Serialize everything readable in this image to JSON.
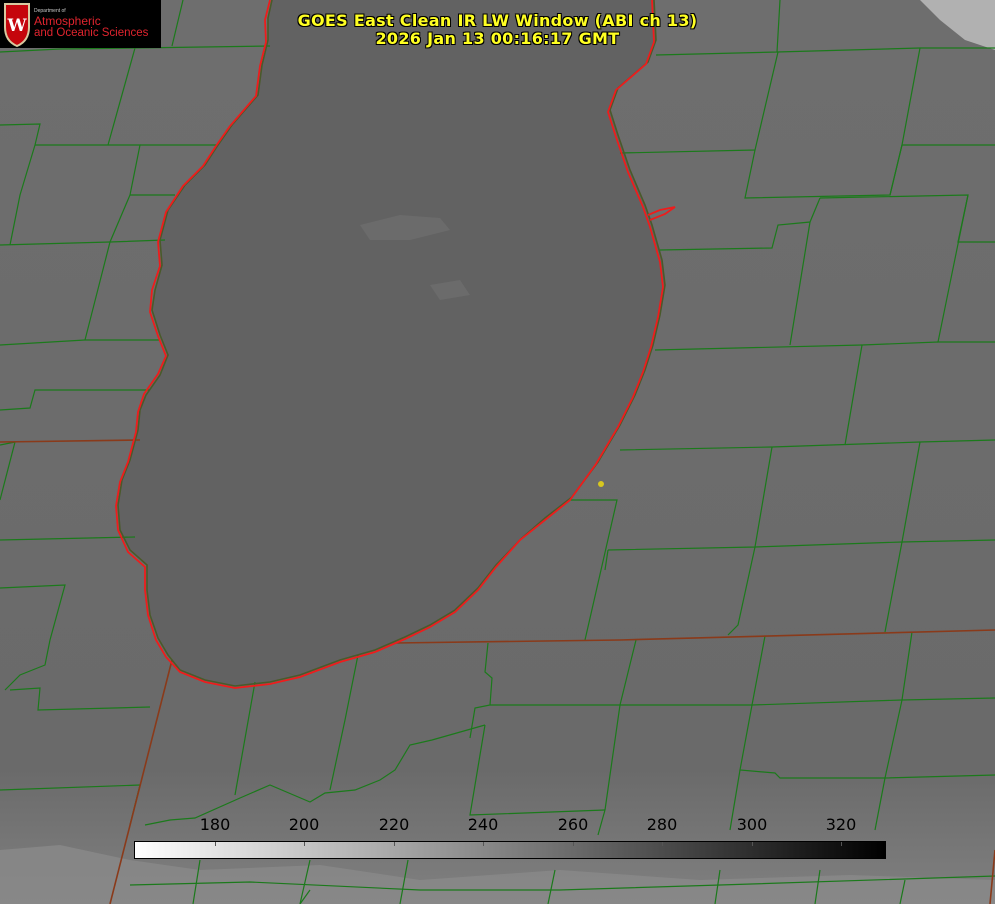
{
  "title": {
    "product": "GOES East Clean IR LW Window (ABI ch 13)",
    "timestamp": "2026 Jan 13 00:16:17 GMT"
  },
  "logo": {
    "department": "Department of",
    "line1": "Atmospheric",
    "line2": "and Oceanic Sciences"
  },
  "colorbar": {
    "ticks": [
      "180",
      "200",
      "220",
      "240",
      "260",
      "280",
      "300",
      "320"
    ],
    "gradient_start_color": "#ffffff",
    "gradient_end_color": "#000000"
  },
  "colors": {
    "title_text": "#ffff22",
    "county_lines": "#1b7a1b",
    "shoreline": "#ee1c1c",
    "city_marker": "#d7c71f"
  }
}
